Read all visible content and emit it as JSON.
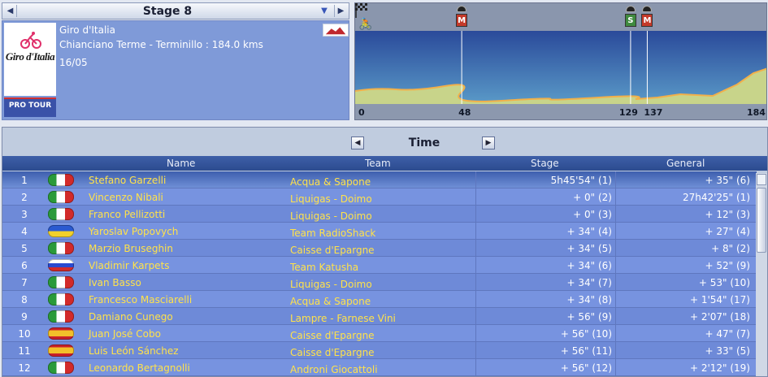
{
  "stage_selector": {
    "title": "Stage 8",
    "prev_icon": "triangle-left",
    "dropdown_icon": "triangle-down",
    "next_icon": "triangle-right"
  },
  "race_info": {
    "race_name": "Giro d'Italia",
    "route": "Chianciano Terme - Terminillo : 184.0 kms",
    "date": "16/05",
    "logo_text": "Giro d'Italia",
    "tour_badge": "PRO TOUR"
  },
  "profile": {
    "km_labels": [
      "0",
      "48",
      "129",
      "137",
      "184"
    ],
    "markers": [
      {
        "type": "M",
        "km": 48
      },
      {
        "type": "S",
        "km": 129
      },
      {
        "type": "M",
        "km": 137
      }
    ],
    "total_km": 184
  },
  "results": {
    "mode_title": "Time",
    "headers": {
      "name": "Name",
      "team": "Team",
      "stage": "Stage",
      "general": "General"
    },
    "rows": [
      {
        "rank": "1",
        "flag": "it",
        "name": "Stefano Garzelli",
        "team": "Acqua & Sapone",
        "stage": "5h45'54\" (1)",
        "general": "+ 35\" (6)"
      },
      {
        "rank": "2",
        "flag": "it",
        "name": "Vincenzo Nibali",
        "team": "Liquigas - Doimo",
        "stage": "+ 0\" (2)",
        "general": "27h42'25\" (1)"
      },
      {
        "rank": "3",
        "flag": "it",
        "name": "Franco Pellizotti",
        "team": "Liquigas - Doimo",
        "stage": "+ 0\" (3)",
        "general": "+ 12\" (3)"
      },
      {
        "rank": "4",
        "flag": "ua",
        "name": "Yaroslav Popovych",
        "team": "Team RadioShack",
        "stage": "+ 34\" (4)",
        "general": "+ 27\" (4)"
      },
      {
        "rank": "5",
        "flag": "it",
        "name": "Marzio Bruseghin",
        "team": "Caisse d'Epargne",
        "stage": "+ 34\" (5)",
        "general": "+ 8\" (2)"
      },
      {
        "rank": "6",
        "flag": "ru",
        "name": "Vladimir Karpets",
        "team": "Team Katusha",
        "stage": "+ 34\" (6)",
        "general": "+ 52\" (9)"
      },
      {
        "rank": "7",
        "flag": "it",
        "name": "Ivan Basso",
        "team": "Liquigas - Doimo",
        "stage": "+ 34\" (7)",
        "general": "+ 53\" (10)"
      },
      {
        "rank": "8",
        "flag": "it",
        "name": "Francesco Masciarelli",
        "team": "Acqua & Sapone",
        "stage": "+ 34\" (8)",
        "general": "+ 1'54\" (17)"
      },
      {
        "rank": "9",
        "flag": "it",
        "name": "Damiano Cunego",
        "team": "Lampre - Farnese Vini",
        "stage": "+ 56\" (9)",
        "general": "+ 2'07\" (18)"
      },
      {
        "rank": "10",
        "flag": "es",
        "name": "Juan José Cobo",
        "team": "Caisse d'Epargne",
        "stage": "+ 56\" (10)",
        "general": "+ 47\" (7)"
      },
      {
        "rank": "11",
        "flag": "es",
        "name": "Luis León Sánchez",
        "team": "Caisse d'Epargne",
        "stage": "+ 56\" (11)",
        "general": "+ 33\" (5)"
      },
      {
        "rank": "12",
        "flag": "it",
        "name": "Leonardo Bertagnolli",
        "team": "Androni Giocattoli",
        "stage": "+ 56\" (12)",
        "general": "+ 2'12\" (19)"
      }
    ]
  },
  "colors": {
    "accent_blue": "#3e5fa8",
    "name_yellow": "#ffe24a",
    "row_blue": "#7793e0"
  }
}
